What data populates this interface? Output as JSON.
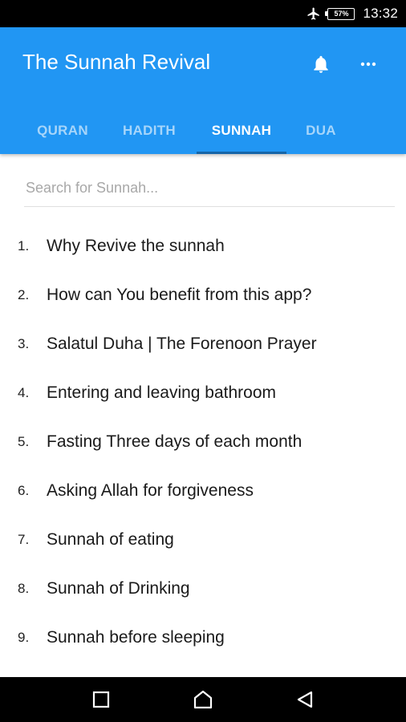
{
  "status_bar": {
    "battery_level": "57%",
    "time": "13:32",
    "icons": [
      "airplane-icon",
      "battery-icon"
    ]
  },
  "app_bar": {
    "title": "The Sunnah Revival",
    "color": "#2196f3",
    "actions": [
      "bell-icon",
      "more-icon"
    ]
  },
  "tabs": {
    "items": [
      {
        "label": "QURAN",
        "active": false
      },
      {
        "label": "HADITH",
        "active": false
      },
      {
        "label": "SUNNAH",
        "active": true
      },
      {
        "label": "DUA",
        "active": false
      }
    ]
  },
  "search": {
    "placeholder": "Search for Sunnah...",
    "value": ""
  },
  "list": {
    "items": [
      {
        "number": "1.",
        "label": "Why Revive the sunnah"
      },
      {
        "number": "2.",
        "label": "How can You benefit from this app?"
      },
      {
        "number": "3.",
        "label": "Salatul Duha | The Forenoon Prayer"
      },
      {
        "number": "4.",
        "label": "Entering and leaving bathroom"
      },
      {
        "number": "5.",
        "label": "Fasting Three days of each month"
      },
      {
        "number": "6.",
        "label": "Asking Allah for forgiveness"
      },
      {
        "number": "7.",
        "label": "Sunnah of eating"
      },
      {
        "number": "8.",
        "label": "Sunnah of Drinking"
      },
      {
        "number": "9.",
        "label": "Sunnah before sleeping"
      }
    ]
  },
  "nav_bar": {
    "buttons": [
      "recents-icon",
      "home-icon",
      "back-icon"
    ]
  }
}
